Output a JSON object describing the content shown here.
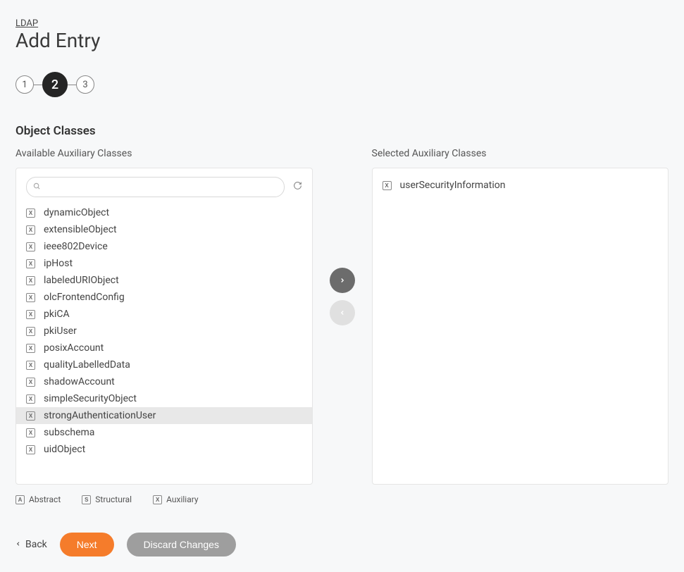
{
  "breadcrumb": "LDAP",
  "page_title": "Add Entry",
  "stepper": {
    "steps": [
      "1",
      "2",
      "3"
    ],
    "active_index": 1
  },
  "section_title": "Object Classes",
  "available": {
    "label": "Available Auxiliary Classes",
    "search_placeholder": "",
    "items": [
      {
        "type": "X",
        "name": "dynamicObject"
      },
      {
        "type": "X",
        "name": "extensibleObject"
      },
      {
        "type": "X",
        "name": "ieee802Device"
      },
      {
        "type": "X",
        "name": "ipHost"
      },
      {
        "type": "X",
        "name": "labeledURIObject"
      },
      {
        "type": "X",
        "name": "olcFrontendConfig"
      },
      {
        "type": "X",
        "name": "pkiCA"
      },
      {
        "type": "X",
        "name": "pkiUser"
      },
      {
        "type": "X",
        "name": "posixAccount"
      },
      {
        "type": "X",
        "name": "qualityLabelledData"
      },
      {
        "type": "X",
        "name": "shadowAccount"
      },
      {
        "type": "X",
        "name": "simpleSecurityObject"
      },
      {
        "type": "X",
        "name": "strongAuthenticationUser"
      },
      {
        "type": "X",
        "name": "subschema"
      },
      {
        "type": "X",
        "name": "uidObject"
      }
    ],
    "selected_index": 12
  },
  "selected": {
    "label": "Selected Auxiliary Classes",
    "items": [
      {
        "type": "X",
        "name": "userSecurityInformation"
      }
    ]
  },
  "legend": [
    {
      "badge": "A",
      "label": "Abstract"
    },
    {
      "badge": "S",
      "label": "Structural"
    },
    {
      "badge": "X",
      "label": "Auxiliary"
    }
  ],
  "actions": {
    "back": "Back",
    "next": "Next",
    "discard": "Discard Changes"
  }
}
